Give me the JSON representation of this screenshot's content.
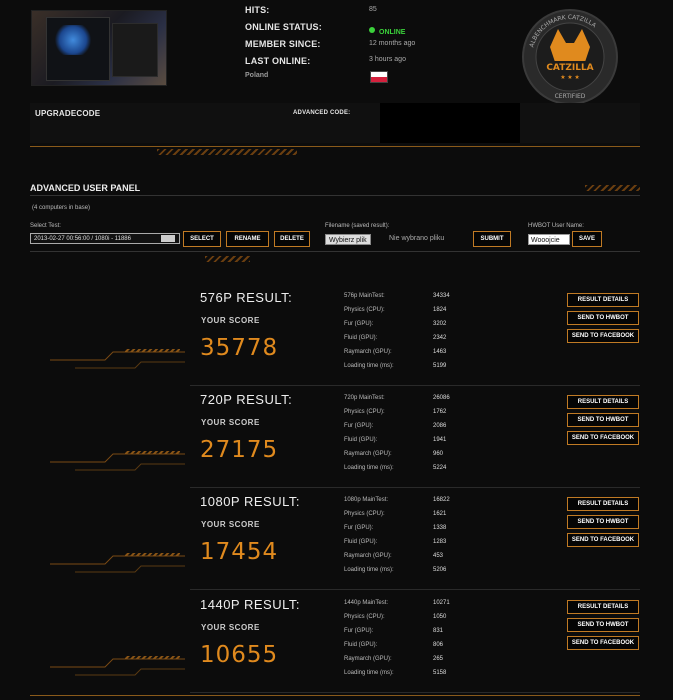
{
  "profile": {
    "hits_label": "HITS:",
    "hits_value": "85",
    "status_label": "ONLINE STATUS:",
    "status_value": "ONLINE",
    "member_label": "MEMBER SINCE:",
    "member_value": "12 months ago",
    "last_label": "LAST ONLINE:",
    "last_value": "3 hours ago",
    "country": "Poland",
    "flag_colors": [
      "#ffffff",
      "#d4213d"
    ],
    "status_color": "#3bd13b"
  },
  "badge": {
    "top_text": "ALBENCHMARK CATZILLA",
    "name": "CATZILLA",
    "bottom_text": "CERTIFIED"
  },
  "codes": {
    "upgrade_label": "UPGRADECODE",
    "advanced_label": "ADVANCED CODE:"
  },
  "panel": {
    "title": "ADVANCED USER PANEL",
    "subtitle": "(4 computers in base)",
    "select_label": "Select Test:",
    "select_value": "2013-02-27 00:56:00 / 1080i - 11886",
    "buttons": {
      "select": "SELECT",
      "rename": "RENAME",
      "delete": "DELETE",
      "submit": "SUBMIT",
      "save": "SAVE"
    },
    "filename_label": "Filename (saved result):",
    "file_button": "Wybierz plik",
    "file_none": "Nie wybrano pliku",
    "hwbot_label": "HWBOT User Name:",
    "hwbot_value": "Wooojcie"
  },
  "results": [
    {
      "title": "576P RESULT:",
      "your_score": "YOUR SCORE",
      "score": "35778",
      "stats": [
        {
          "label": "576p MainTest:",
          "value": "34334"
        },
        {
          "label": "Physics (CPU):",
          "value": "1824"
        },
        {
          "label": "Fur (GPU):",
          "value": "3202"
        },
        {
          "label": "Fluid (GPU):",
          "value": "2342"
        },
        {
          "label": "Raymarch (GPU):",
          "value": "1463"
        },
        {
          "label": "Loading time (ms):",
          "value": "5199"
        }
      ],
      "actions": [
        "RESULT DETAILS",
        "SEND TO HWBOT",
        "SEND TO FACEBOOK"
      ]
    },
    {
      "title": "720P RESULT:",
      "your_score": "YOUR SCORE",
      "score": "27175",
      "stats": [
        {
          "label": "720p MainTest:",
          "value": "26086"
        },
        {
          "label": "Physics (CPU):",
          "value": "1762"
        },
        {
          "label": "Fur (GPU):",
          "value": "2086"
        },
        {
          "label": "Fluid (GPU):",
          "value": "1941"
        },
        {
          "label": "Raymarch (GPU):",
          "value": "960"
        },
        {
          "label": "Loading time (ms):",
          "value": "5224"
        }
      ],
      "actions": [
        "RESULT DETAILS",
        "SEND TO HWBOT",
        "SEND TO FACEBOOK"
      ]
    },
    {
      "title": "1080P RESULT:",
      "your_score": "YOUR SCORE",
      "score": "17454",
      "stats": [
        {
          "label": "1080p MainTest:",
          "value": "16822"
        },
        {
          "label": "Physics (CPU):",
          "value": "1621"
        },
        {
          "label": "Fur (GPU):",
          "value": "1338"
        },
        {
          "label": "Fluid (GPU):",
          "value": "1283"
        },
        {
          "label": "Raymarch (GPU):",
          "value": "453"
        },
        {
          "label": "Loading time (ms):",
          "value": "5206"
        }
      ],
      "actions": [
        "RESULT DETAILS",
        "SEND TO HWBOT",
        "SEND TO FACEBOOK"
      ]
    },
    {
      "title": "1440P RESULT:",
      "your_score": "YOUR SCORE",
      "score": "10655",
      "stats": [
        {
          "label": "1440p MainTest:",
          "value": "10271"
        },
        {
          "label": "Physics (CPU):",
          "value": "1050"
        },
        {
          "label": "Fur (GPU):",
          "value": "831"
        },
        {
          "label": "Fluid (GPU):",
          "value": "806"
        },
        {
          "label": "Raymarch (GPU):",
          "value": "265"
        },
        {
          "label": "Loading time (ms):",
          "value": "5158"
        }
      ],
      "actions": [
        "RESULT DETAILS",
        "SEND TO HWBOT",
        "SEND TO FACEBOOK"
      ]
    }
  ],
  "accent_color": "#e08a1e"
}
